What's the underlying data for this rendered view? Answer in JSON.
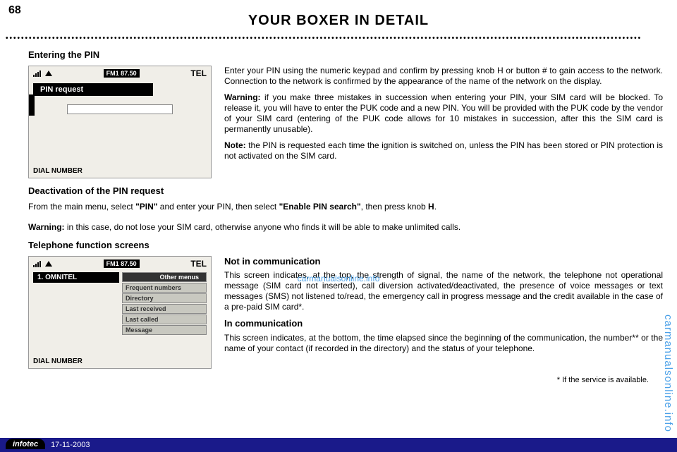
{
  "page_number": "68",
  "page_title": "YOUR BOXER IN DETAIL",
  "dots": "••••••••••••••••••••••••••••••••••••••••••••••••••••••••••••••••••••••••••••••••••••••••••••••••••••••••••••••••••••••••••••••••••••••••••••••••••••••••••••••••••••",
  "section1": {
    "heading": "Entering the PIN",
    "screen": {
      "fm": "FM1  87.50",
      "tel": "TEL",
      "pin_request": "PIN request",
      "dial": "DIAL NUMBER"
    },
    "p1": "Enter your PIN using the numeric keypad and confirm by pressing knob H or button # to gain access to the network. Connection to the network is confirmed by the appearance of the name of the network on the display.",
    "p2_label": "Warning:",
    "p2": " if you make three mistakes in succession when entering your PIN, your SIM card will be blocked. To release it, you will have to enter the PUK code and a new PIN. You will be provided with the PUK code by the vendor of your SIM card (entering of the PUK code allows for 10 mistakes in succession, after this the SIM card is permanently unusable).",
    "p3_label": "Note:",
    "p3": " the PIN is requested each time the ignition is switched on, unless the PIN has been stored or PIN protection is not activated on the SIM card."
  },
  "section2": {
    "heading": "Deactivation of the PIN request",
    "p1a": "From the main menu, select ",
    "p1b": "\"PIN\"",
    "p1c": " and enter your PIN, then select ",
    "p1d": "\"Enable PIN search\"",
    "p1e": ", then press knob ",
    "p1f": "H",
    "p1g": ".",
    "warning_label": "Warning:",
    "warning": " in this case, do not lose your SIM card, otherwise anyone who finds it will be able to make unlimited calls."
  },
  "section3": {
    "heading": "Telephone function screens",
    "screen": {
      "fm": "FM1  87.50",
      "tel": "TEL",
      "omnitel": "1. OMNITEL",
      "menu": [
        "Other menus",
        "Frequent numbers",
        "Directory",
        "Last received",
        "Last called",
        "Message"
      ],
      "dial": "DIAL NUMBER"
    },
    "sub1_heading": "Not in communication",
    "sub1": "This screen indicates, at the top, the strength of signal, the name of the network, the telephone not operational message (SIM card not inserted), call diversion activated/deactivated, the presence of voice messages or text messages (SMS) not listened to/read, the emergency call in progress message and the credit available in the case of a pre-paid SIM card*.",
    "sub2_heading": "In communication",
    "sub2": "This screen indicates, at the bottom, the time elapsed since the beginning of the communication, the number** or the name of your contact (if recorded in the directory) and the status of your telephone."
  },
  "footnote": "* If the service is available.",
  "watermark_center": "carmanualsonline.info",
  "watermark_side": "carmanualsonline.info",
  "footer": {
    "brand": "infotec",
    "date": "17-11-2003"
  }
}
